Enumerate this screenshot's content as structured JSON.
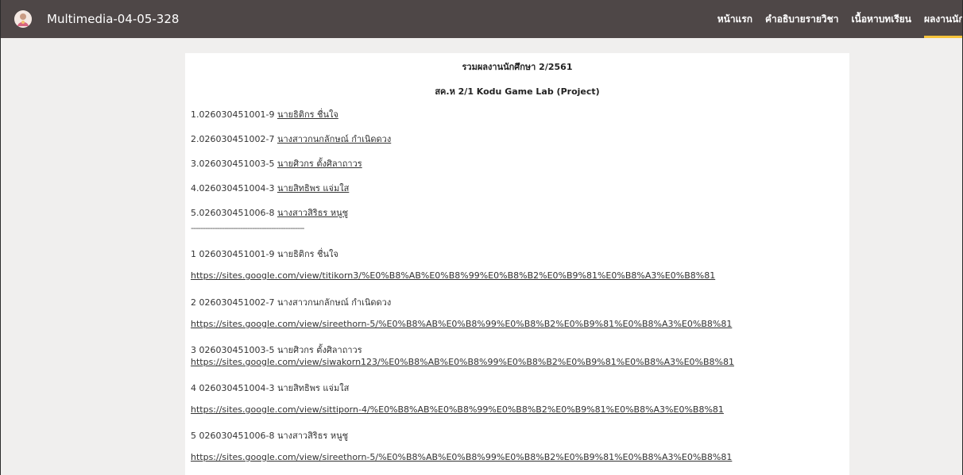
{
  "header": {
    "site_title": "Multimedia-04-05-328",
    "nav": [
      "หน้าแรก",
      "คำอธิบายรายวิชา",
      "เนื้อหาบทเรียน",
      "ผลงานนักศึกษา"
    ]
  },
  "content": {
    "title": "รวมผลงานนักศึกษา  2/2561",
    "subtitle": "สค.ห 2/1  Kodu Game Lab (Project)",
    "students": [
      {
        "prefix": "1.026030451001-9 ",
        "name": "นายธิติกร ชื่นใจ"
      },
      {
        "prefix": "2.026030451002-7 ",
        "name": "นางสาวกนกลักษณ์ กำเนิดดวง"
      },
      {
        "prefix": "3.026030451003-5 ",
        "name": "นายศิวกร ตั้งศิลาถาวร"
      },
      {
        "prefix": "4.026030451004-3 ",
        "name": "นายสิทธิพร แจ่มใส"
      },
      {
        "prefix": "5.026030451006-8 ",
        "name": "นางสาวสิริธร หนูชู"
      }
    ],
    "divider": "------------------------------------------------",
    "entries": [
      {
        "label": "1  026030451001-9 นายธิติกร ชื่นใจ",
        "url": "https://sites.google.com/view/titikorn3/%E0%B8%AB%E0%B8%99%E0%B8%B2%E0%B9%81%E0%B8%A3%E0%B8%81"
      },
      {
        "label": "2 026030451002-7 นางสาวกนกลักษณ์ กำเนิดดวง",
        "url": "https://sites.google.com/view/sireethorn-5/%E0%B8%AB%E0%B8%99%E0%B8%B2%E0%B9%81%E0%B8%A3%E0%B8%81"
      },
      {
        "label": "3 026030451003-5 นายศิวกร ตั้งศิลาถาวร",
        "url": "https://sites.google.com/view/siwakorn123/%E0%B8%AB%E0%B8%99%E0%B8%B2%E0%B9%81%E0%B8%A3%E0%B8%81"
      },
      {
        "label": "4 026030451004-3 นายสิทธิพร แจ่มใส",
        "url": "https://sites.google.com/view/sittiporn-4/%E0%B8%AB%E0%B8%99%E0%B8%B2%E0%B9%81%E0%B8%A3%E0%B8%81"
      },
      {
        "label": "5 026030451006-8 นางสาวสิริธร หนูชู",
        "url": "https://sites.google.com/view/sireethorn-5/%E0%B8%AB%E0%B8%99%E0%B8%B2%E0%B9%81%E0%B8%A3%E0%B8%81"
      }
    ]
  }
}
